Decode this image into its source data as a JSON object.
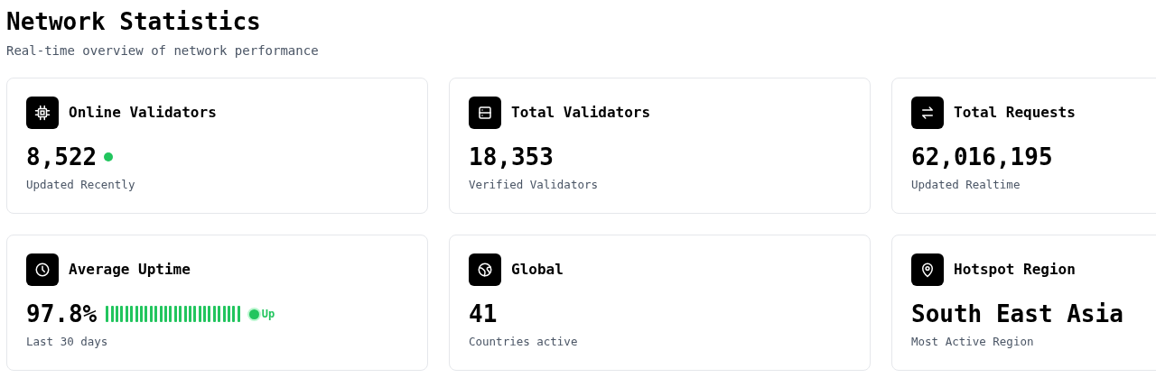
{
  "header": {
    "title": "Network Statistics",
    "subtitle": "Real-time overview of network performance"
  },
  "cards": [
    {
      "kind": "live",
      "title": "Online Validators",
      "value": "8,522",
      "caption": "Updated Recently"
    },
    {
      "kind": "plain",
      "title": "Total Validators",
      "value": "18,353",
      "caption": "Verified Validators"
    },
    {
      "kind": "plain",
      "title": "Total Requests",
      "value": "62,016,195",
      "caption": "Updated Realtime"
    },
    {
      "kind": "uptime",
      "title": "Average Uptime",
      "value": "97.8%",
      "status": "Up",
      "caption": "Last 30 days"
    },
    {
      "kind": "plain",
      "title": "Global",
      "value": "41",
      "caption": "Countries active"
    },
    {
      "kind": "plain",
      "title": "Hotspot Region",
      "value": "South East Asia",
      "caption": "Most Active Region"
    }
  ]
}
